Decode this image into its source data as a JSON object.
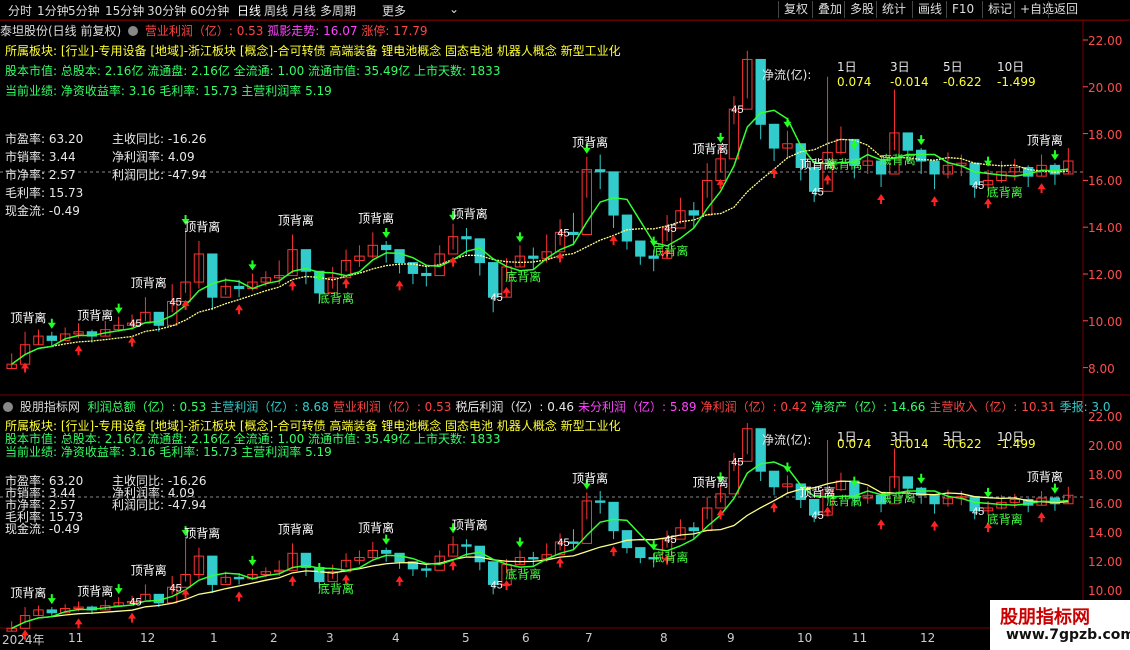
{
  "toolbar": {
    "periods": [
      "分时",
      "1分钟",
      "5分钟",
      "15分钟",
      "30分钟",
      "60分钟",
      "日线",
      "周线",
      "月线",
      "多周期",
      "更多"
    ],
    "active_period": "日线",
    "more_arrow": "⌄",
    "buttons": [
      "复权",
      "叠加",
      "多股",
      "统计",
      "画线",
      "F10",
      "标记",
      "+自选",
      "返回"
    ]
  },
  "main_panel": {
    "title": "泰坦股份(日线 前复权)",
    "indicator_name": "营业利润（亿）",
    "indicator_value": ": 0.53",
    "trend_label": "孤影走势",
    "trend_value": ": 16.07",
    "limit_label": "涨停",
    "limit_value": ": 17.79",
    "sector_line": "所属板块: [行业]-专用设备 [地域]-浙江板块 [概念]-合可转债 高端装备 锂电池概念 固态电池 机器人概念 新型工业化",
    "capital_line": "股本市值: 总股本: 2.16亿 流通盘: 2.16亿 全流通: 1.00 流通市值: 35.49亿 上市天数: 1833",
    "perf_line": "当前业绩: 净资收益率: 3.16 毛利率: 15.73 主营利润率 5.19",
    "ratios_left": [
      "市盈率: 63.20",
      "市销率: 3.44",
      "市净率: 2.57",
      "毛利率: 15.73",
      "现金流: -0.49"
    ],
    "ratios_right": [
      "主收同比: -16.26",
      "净利润率: 4.09",
      "利润同比: -47.94"
    ],
    "netflow_label": "净流(亿):",
    "netflow_headers": [
      "1日",
      "3日",
      "5日",
      "10日"
    ],
    "netflow_values": [
      "0.074",
      "-0.014",
      "-0.622",
      "-1.499"
    ],
    "y_ticks": [
      "22.00",
      "20.00",
      "18.00",
      "16.00",
      "14.00",
      "12.00",
      "10.00",
      "8.00"
    ]
  },
  "sub_panel": {
    "title": "股朋指标网",
    "items": [
      {
        "label": "利润总额（亿）",
        "value": ": 0.53"
      },
      {
        "label": "主营利润（亿）",
        "value": ": 8.68"
      },
      {
        "label": "营业利润（亿）",
        "value": ": 0.53"
      },
      {
        "label": "税后利润（亿）",
        "value": ": 0.46"
      },
      {
        "label": "未分利润（亿）",
        "value": ": 5.89"
      },
      {
        "label": "净利润（亿）",
        "value": ": 0.42"
      },
      {
        "label": "净资产（亿）",
        "value": ": 14.66"
      },
      {
        "label": "主营收入（亿）",
        "value": ": 10.31"
      },
      {
        "label": "季报",
        "value": ": 3.0"
      }
    ],
    "y_ticks": [
      "22.00",
      "20.00",
      "18.00",
      "16.00",
      "14.00",
      "12.00",
      "10.00"
    ]
  },
  "chart_labels": {
    "top_divergence": "顶背离",
    "bottom_divergence": "底背离",
    "fortyfive": "45"
  },
  "x_axis": [
    "2024年",
    "11",
    "12",
    "1",
    "2",
    "3",
    "4",
    "5",
    "6",
    "7",
    "8",
    "9",
    "10",
    "11",
    "12"
  ],
  "watermark": {
    "name": "股朋指标网",
    "url": "www.7gpzb.com"
  },
  "colors": {
    "up": "#ff3333",
    "down": "#33cccc",
    "ma": "#ffff88",
    "panel_border": "#7a0000"
  },
  "chart_data": {
    "type": "candlestick",
    "ylim": [
      7,
      22.5
    ],
    "closes": [
      7.5,
      8.4,
      8.8,
      8.6,
      8.9,
      9.0,
      8.8,
      9.1,
      9.3,
      9.4,
      9.9,
      9.3,
      10.4,
      11.3,
      12.6,
      10.6,
      11.1,
      11.0,
      11.3,
      11.5,
      11.6,
      12.8,
      11.8,
      10.8,
      11.5,
      12.3,
      12.5,
      13.0,
      12.8,
      12.2,
      11.7,
      11.6,
      12.6,
      13.4,
      13.3,
      12.2,
      10.6,
      12.0,
      12.5,
      12.4,
      12.7,
      13.6,
      13.5,
      16.5,
      16.4,
      14.4,
      13.2,
      12.5,
      12.4,
      13.8,
      14.6,
      14.4,
      16.0,
      17.0,
      19.3,
      21.6,
      18.6,
      17.5,
      17.7,
      16.6,
      15.5,
      17.3,
      17.9,
      16.7,
      16.9,
      16.3,
      18.2,
      17.4,
      16.9,
      16.3,
      16.7,
      16.8,
      15.8,
      16.0,
      16.4,
      16.6,
      16.2,
      16.7,
      16.3,
      16.9
    ],
    "highs": [
      8.0,
      9.0,
      9.1,
      9.0,
      9.2,
      9.4,
      9.1,
      9.5,
      9.7,
      9.8,
      10.6,
      9.8,
      11.2,
      13.8,
      13.2,
      11.0,
      11.5,
      11.4,
      11.7,
      11.8,
      12.3,
      13.5,
      12.3,
      11.2,
      12.0,
      12.8,
      13.0,
      13.6,
      13.2,
      12.6,
      12.1,
      12.1,
      13.0,
      14.0,
      13.8,
      12.6,
      11.0,
      12.4,
      13.0,
      12.9,
      13.5,
      14.2,
      14.5,
      17.1,
      17.2,
      14.8,
      13.6,
      12.9,
      12.8,
      14.4,
      15.2,
      15.0,
      16.8,
      17.6,
      19.9,
      22.0,
      19.3,
      18.1,
      18.3,
      17.2,
      16.1,
      20.8,
      18.5,
      17.3,
      17.5,
      16.9,
      20.2,
      18.0,
      17.5,
      16.9,
      17.3,
      17.2,
      16.4,
      16.5,
      16.9,
      17.0,
      16.7,
      17.2,
      16.8,
      17.5
    ],
    "lows": [
      7.3,
      7.9,
      8.4,
      8.3,
      8.6,
      8.7,
      8.5,
      8.8,
      9.0,
      9.1,
      9.5,
      9.0,
      9.9,
      10.8,
      11.0,
      10.0,
      10.7,
      10.6,
      10.9,
      11.1,
      11.2,
      11.7,
      11.2,
      10.3,
      11.0,
      11.8,
      12.0,
      12.4,
      12.2,
      11.7,
      11.2,
      11.1,
      12.0,
      12.8,
      12.6,
      11.6,
      9.9,
      11.4,
      12.0,
      11.9,
      12.2,
      13.0,
      13.0,
      15.2,
      15.6,
      13.8,
      12.8,
      12.1,
      11.8,
      13.2,
      14.0,
      13.8,
      15.2,
      16.4,
      18.6,
      19.8,
      17.9,
      16.9,
      17.0,
      16.0,
      15.0,
      16.6,
      17.2,
      16.1,
      16.3,
      15.7,
      17.4,
      16.8,
      16.3,
      15.6,
      16.1,
      16.2,
      15.2,
      15.5,
      15.9,
      16.0,
      15.7,
      16.2,
      15.8,
      16.3
    ]
  }
}
